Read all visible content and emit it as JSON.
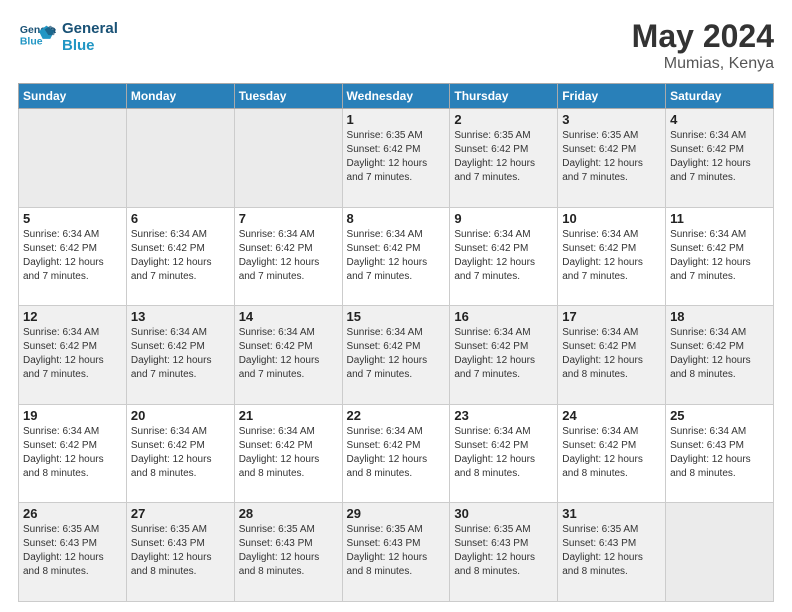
{
  "logo": {
    "line1": "General",
    "line2": "Blue"
  },
  "header": {
    "month": "May 2024",
    "location": "Mumias, Kenya"
  },
  "weekdays": [
    "Sunday",
    "Monday",
    "Tuesday",
    "Wednesday",
    "Thursday",
    "Friday",
    "Saturday"
  ],
  "weeks": [
    [
      {
        "day": "",
        "sunrise": "",
        "sunset": "",
        "daylight": "",
        "empty": true
      },
      {
        "day": "",
        "sunrise": "",
        "sunset": "",
        "daylight": "",
        "empty": true
      },
      {
        "day": "",
        "sunrise": "",
        "sunset": "",
        "daylight": "",
        "empty": true
      },
      {
        "day": "1",
        "sunrise": "Sunrise: 6:35 AM",
        "sunset": "Sunset: 6:42 PM",
        "daylight": "Daylight: 12 hours and 7 minutes.",
        "empty": false
      },
      {
        "day": "2",
        "sunrise": "Sunrise: 6:35 AM",
        "sunset": "Sunset: 6:42 PM",
        "daylight": "Daylight: 12 hours and 7 minutes.",
        "empty": false
      },
      {
        "day": "3",
        "sunrise": "Sunrise: 6:35 AM",
        "sunset": "Sunset: 6:42 PM",
        "daylight": "Daylight: 12 hours and 7 minutes.",
        "empty": false
      },
      {
        "day": "4",
        "sunrise": "Sunrise: 6:34 AM",
        "sunset": "Sunset: 6:42 PM",
        "daylight": "Daylight: 12 hours and 7 minutes.",
        "empty": false
      }
    ],
    [
      {
        "day": "5",
        "sunrise": "Sunrise: 6:34 AM",
        "sunset": "Sunset: 6:42 PM",
        "daylight": "Daylight: 12 hours and 7 minutes.",
        "empty": false
      },
      {
        "day": "6",
        "sunrise": "Sunrise: 6:34 AM",
        "sunset": "Sunset: 6:42 PM",
        "daylight": "Daylight: 12 hours and 7 minutes.",
        "empty": false
      },
      {
        "day": "7",
        "sunrise": "Sunrise: 6:34 AM",
        "sunset": "Sunset: 6:42 PM",
        "daylight": "Daylight: 12 hours and 7 minutes.",
        "empty": false
      },
      {
        "day": "8",
        "sunrise": "Sunrise: 6:34 AM",
        "sunset": "Sunset: 6:42 PM",
        "daylight": "Daylight: 12 hours and 7 minutes.",
        "empty": false
      },
      {
        "day": "9",
        "sunrise": "Sunrise: 6:34 AM",
        "sunset": "Sunset: 6:42 PM",
        "daylight": "Daylight: 12 hours and 7 minutes.",
        "empty": false
      },
      {
        "day": "10",
        "sunrise": "Sunrise: 6:34 AM",
        "sunset": "Sunset: 6:42 PM",
        "daylight": "Daylight: 12 hours and 7 minutes.",
        "empty": false
      },
      {
        "day": "11",
        "sunrise": "Sunrise: 6:34 AM",
        "sunset": "Sunset: 6:42 PM",
        "daylight": "Daylight: 12 hours and 7 minutes.",
        "empty": false
      }
    ],
    [
      {
        "day": "12",
        "sunrise": "Sunrise: 6:34 AM",
        "sunset": "Sunset: 6:42 PM",
        "daylight": "Daylight: 12 hours and 7 minutes.",
        "empty": false
      },
      {
        "day": "13",
        "sunrise": "Sunrise: 6:34 AM",
        "sunset": "Sunset: 6:42 PM",
        "daylight": "Daylight: 12 hours and 7 minutes.",
        "empty": false
      },
      {
        "day": "14",
        "sunrise": "Sunrise: 6:34 AM",
        "sunset": "Sunset: 6:42 PM",
        "daylight": "Daylight: 12 hours and 7 minutes.",
        "empty": false
      },
      {
        "day": "15",
        "sunrise": "Sunrise: 6:34 AM",
        "sunset": "Sunset: 6:42 PM",
        "daylight": "Daylight: 12 hours and 7 minutes.",
        "empty": false
      },
      {
        "day": "16",
        "sunrise": "Sunrise: 6:34 AM",
        "sunset": "Sunset: 6:42 PM",
        "daylight": "Daylight: 12 hours and 7 minutes.",
        "empty": false
      },
      {
        "day": "17",
        "sunrise": "Sunrise: 6:34 AM",
        "sunset": "Sunset: 6:42 PM",
        "daylight": "Daylight: 12 hours and 8 minutes.",
        "empty": false
      },
      {
        "day": "18",
        "sunrise": "Sunrise: 6:34 AM",
        "sunset": "Sunset: 6:42 PM",
        "daylight": "Daylight: 12 hours and 8 minutes.",
        "empty": false
      }
    ],
    [
      {
        "day": "19",
        "sunrise": "Sunrise: 6:34 AM",
        "sunset": "Sunset: 6:42 PM",
        "daylight": "Daylight: 12 hours and 8 minutes.",
        "empty": false
      },
      {
        "day": "20",
        "sunrise": "Sunrise: 6:34 AM",
        "sunset": "Sunset: 6:42 PM",
        "daylight": "Daylight: 12 hours and 8 minutes.",
        "empty": false
      },
      {
        "day": "21",
        "sunrise": "Sunrise: 6:34 AM",
        "sunset": "Sunset: 6:42 PM",
        "daylight": "Daylight: 12 hours and 8 minutes.",
        "empty": false
      },
      {
        "day": "22",
        "sunrise": "Sunrise: 6:34 AM",
        "sunset": "Sunset: 6:42 PM",
        "daylight": "Daylight: 12 hours and 8 minutes.",
        "empty": false
      },
      {
        "day": "23",
        "sunrise": "Sunrise: 6:34 AM",
        "sunset": "Sunset: 6:42 PM",
        "daylight": "Daylight: 12 hours and 8 minutes.",
        "empty": false
      },
      {
        "day": "24",
        "sunrise": "Sunrise: 6:34 AM",
        "sunset": "Sunset: 6:42 PM",
        "daylight": "Daylight: 12 hours and 8 minutes.",
        "empty": false
      },
      {
        "day": "25",
        "sunrise": "Sunrise: 6:34 AM",
        "sunset": "Sunset: 6:43 PM",
        "daylight": "Daylight: 12 hours and 8 minutes.",
        "empty": false
      }
    ],
    [
      {
        "day": "26",
        "sunrise": "Sunrise: 6:35 AM",
        "sunset": "Sunset: 6:43 PM",
        "daylight": "Daylight: 12 hours and 8 minutes.",
        "empty": false
      },
      {
        "day": "27",
        "sunrise": "Sunrise: 6:35 AM",
        "sunset": "Sunset: 6:43 PM",
        "daylight": "Daylight: 12 hours and 8 minutes.",
        "empty": false
      },
      {
        "day": "28",
        "sunrise": "Sunrise: 6:35 AM",
        "sunset": "Sunset: 6:43 PM",
        "daylight": "Daylight: 12 hours and 8 minutes.",
        "empty": false
      },
      {
        "day": "29",
        "sunrise": "Sunrise: 6:35 AM",
        "sunset": "Sunset: 6:43 PM",
        "daylight": "Daylight: 12 hours and 8 minutes.",
        "empty": false
      },
      {
        "day": "30",
        "sunrise": "Sunrise: 6:35 AM",
        "sunset": "Sunset: 6:43 PM",
        "daylight": "Daylight: 12 hours and 8 minutes.",
        "empty": false
      },
      {
        "day": "31",
        "sunrise": "Sunrise: 6:35 AM",
        "sunset": "Sunset: 6:43 PM",
        "daylight": "Daylight: 12 hours and 8 minutes.",
        "empty": false
      },
      {
        "day": "",
        "sunrise": "",
        "sunset": "",
        "daylight": "",
        "empty": true
      }
    ]
  ]
}
